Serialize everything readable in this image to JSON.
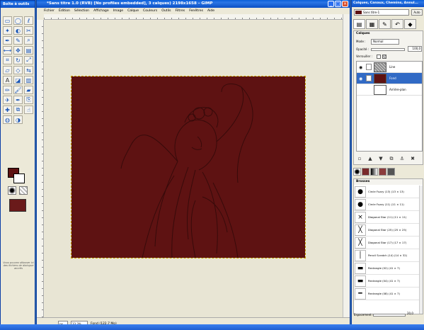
{
  "toolbox": {
    "title": "Boîte à outils",
    "tools": [
      "rect-select",
      "ellipse-select",
      "lasso",
      "fuzzy-select",
      "color-select",
      "scissors",
      "paths",
      "color-picker",
      "zoom",
      "measure",
      "move",
      "align",
      "crop",
      "rotate",
      "scale",
      "shear",
      "perspective",
      "flip",
      "text",
      "bucket-fill",
      "blend",
      "pencil",
      "paintbrush",
      "eraser",
      "airbrush",
      "ink",
      "clone",
      "heal",
      "perspective-clone",
      "smudge",
      "blur",
      "dodge-burn"
    ],
    "note": "Vous pouvez déposer ici des fichiers de dialogue ancrés"
  },
  "image_window": {
    "title": "*Sans titre 1.0 (RVB) [No profiles embedded], 3 calques) 2198x1658 – GIMP",
    "menu": [
      "Fichier",
      "Édition",
      "Sélection",
      "Affichage",
      "Image",
      "Calque",
      "Couleurs",
      "Outils",
      "Filtres",
      "Fenêtres",
      "Aide"
    ],
    "unit": "px",
    "zoom": "33,3%",
    "status": "Fond (122,7 Mo)"
  },
  "dock": {
    "title": "Calques, Canaux, Chemins, Annul...",
    "image_selector": "Sans titre-1",
    "auto_label": "Auto",
    "layers": {
      "header": "Calques",
      "mode_label": "Mode :",
      "mode_value": "Normal",
      "opacity_label": "Opacité :",
      "opacity_value": "100,0",
      "lock_label": "Verrouiller :",
      "items": [
        {
          "name": "Line",
          "thumb": "#9a9a9a"
        },
        {
          "name": "Fond",
          "thumb": "#5e1212"
        },
        {
          "name": "Arrière-plan",
          "thumb": "#ffffff"
        }
      ]
    },
    "brushes": {
      "header": "Brosses",
      "items": [
        {
          "name": "Circle Fuzzy (13) (13 × 13)",
          "glyph": "●"
        },
        {
          "name": "Circle Fuzzy (11) (11 × 11)",
          "glyph": "●"
        },
        {
          "name": "Diagonal Star (11) (11 × 11)",
          "glyph": "×"
        },
        {
          "name": "Diagonal Star (25) (25 × 25)",
          "glyph": "╳"
        },
        {
          "name": "Diagonal Star (17) (17 × 17)",
          "glyph": "╳"
        },
        {
          "name": "Pencil Scratch (14) (14 × 32)",
          "glyph": "│"
        },
        {
          "name": "Rectangle (02) (41 × 7)",
          "glyph": "▬"
        },
        {
          "name": "Rectangle (04) (41 × 7)",
          "glyph": "▬"
        },
        {
          "name": "Rectangle (08) (41 × 7)",
          "glyph": "━"
        }
      ],
      "spacing_label": "Espacement :",
      "spacing_value": "20,0"
    }
  }
}
